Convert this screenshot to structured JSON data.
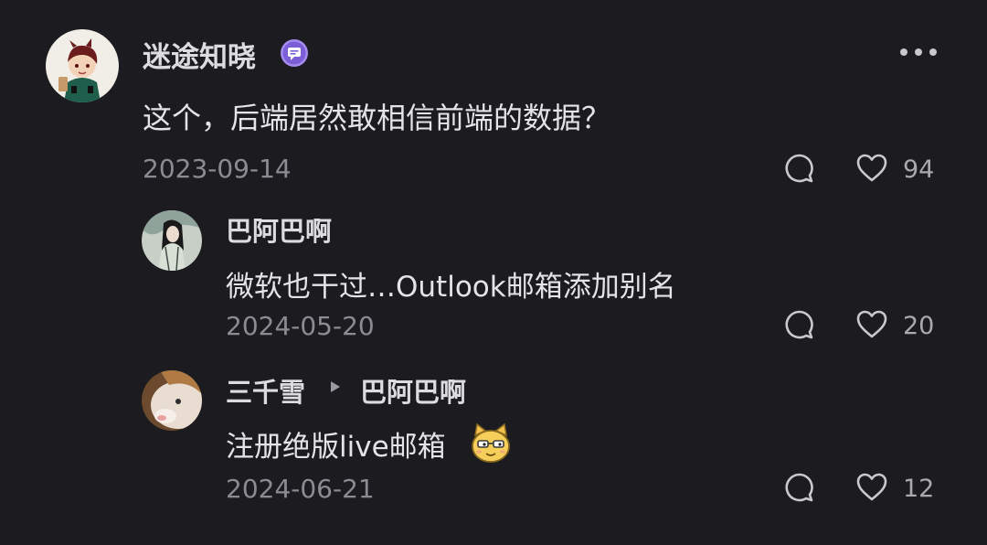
{
  "comment": {
    "author": "迷途知晓",
    "badge_icon": "message-badge-icon",
    "text": "这个，后端居然敢相信前端的数据？",
    "date": "2023-09-14",
    "like_count": "94",
    "more_icon": "more-dots-icon"
  },
  "replies": [
    {
      "author": "巴阿巴啊",
      "text": "微软也干过…Outlook邮箱添加别名",
      "date": "2024-05-20",
      "like_count": "20"
    },
    {
      "author": "三千雪",
      "reply_to": "巴阿巴啊",
      "text": "注册绝版live邮箱",
      "emoji_icon": "cat-face-emoji-icon",
      "date": "2024-06-21",
      "like_count": "12"
    }
  ],
  "icons": {
    "reply": "comment-bubble-icon",
    "like": "heart-icon"
  },
  "colors": {
    "background": "#1c1c20",
    "text": "#e4e4e7",
    "muted": "#8b8b91",
    "badge": "#a58cf0"
  }
}
